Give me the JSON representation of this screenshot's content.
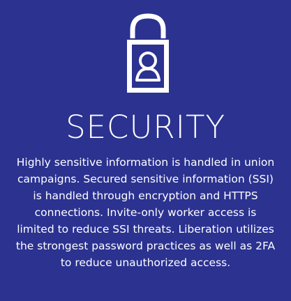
{
  "section": {
    "icon": "lock-with-person-icon",
    "title": "SECURITY",
    "description": "Highly sensitive information is handled in union campaigns. Secured sensitive information (SSI) is handled through encryption and HTTPS connections. Invite-only worker access is limited to reduce SSI threats. Liberation utilizes the strongest password practices as well as 2FA to reduce unauthorized access."
  },
  "colors": {
    "background": "#2b3290",
    "foreground": "#ffffff"
  }
}
